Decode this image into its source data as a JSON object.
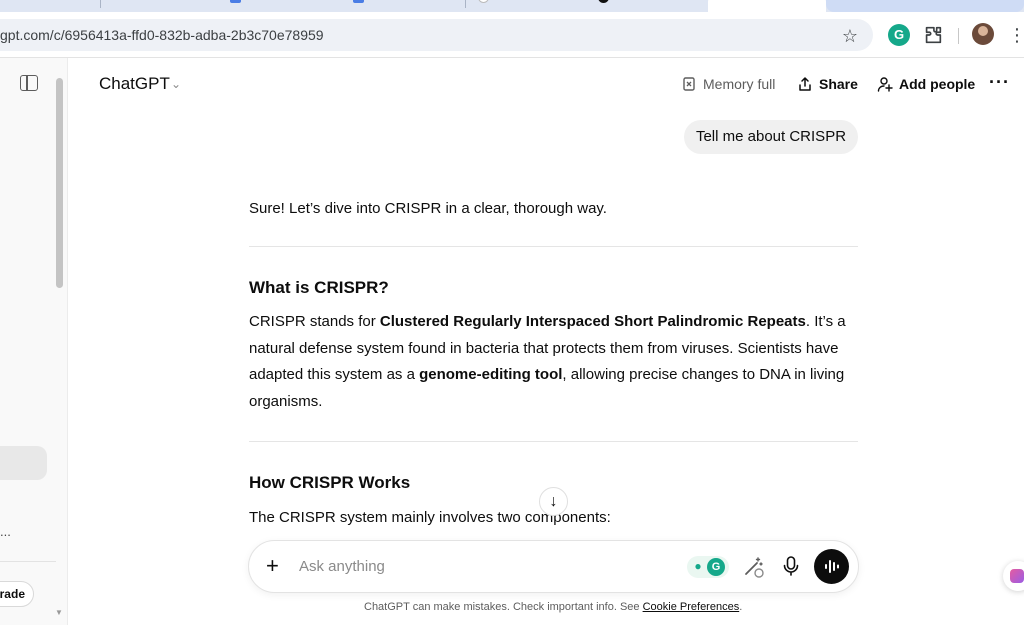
{
  "browser": {
    "url": "gpt.com/c/6956413a-ffd0-832b-adba-2b3c70e78959",
    "extension_letter": "G"
  },
  "sidebar": {
    "more_label": "...",
    "upgrade_label": "rade"
  },
  "header": {
    "model_name": "ChatGPT",
    "memory_label": "Memory full",
    "share_label": "Share",
    "add_people_label": "Add people"
  },
  "conversation": {
    "user_message": "Tell me about CRISPR",
    "answer": {
      "intro": "Sure! Let’s dive into CRISPR in a clear, thorough way.",
      "section1": {
        "heading": "What is CRISPR?",
        "p_before": "CRISPR stands for ",
        "bold1": "Clustered Regularly Interspaced Short Palindromic Repeats",
        "p_middle": ". It’s a natural defense system found in bacteria that protects them from viruses. Scientists have adapted this system as a ",
        "bold2": "genome-editing tool",
        "p_after": ", allowing precise changes to DNA in living organisms."
      },
      "section2": {
        "heading": "How CRISPR Works",
        "text": "The CRISPR system mainly involves two components:"
      }
    }
  },
  "composer": {
    "placeholder": "Ask anything",
    "grammarly_letter": "G"
  },
  "footer": {
    "disclaimer": "ChatGPT can make mistakes. Check important info. See ",
    "link": "Cookie Preferences",
    "end": "."
  },
  "colors": {
    "brand_green": "#15a88a",
    "bubble_bg": "#f0f0f0",
    "voice_button": "#0d0d0d"
  }
}
